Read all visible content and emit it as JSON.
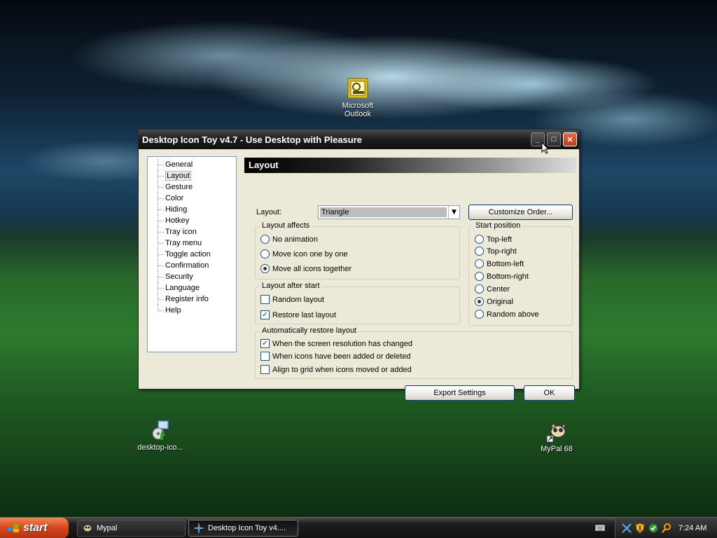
{
  "desktop": {
    "icons": [
      {
        "label_line1": "Microsoft",
        "label_line2": "Outlook",
        "icon": "outlook-icon"
      },
      {
        "label": "desktop-ico...",
        "icon": "installer-icon"
      },
      {
        "label": "MyPal 68",
        "icon": "mypal-icon"
      }
    ]
  },
  "window": {
    "title": "Desktop Icon Toy v4.7 - Use Desktop with Pleasure",
    "minimize": "_",
    "maximize": "□",
    "close": "✕"
  },
  "nav": {
    "items": [
      {
        "label": "General"
      },
      {
        "label": "Layout",
        "selected": true
      },
      {
        "label": "Gesture"
      },
      {
        "label": "Color"
      },
      {
        "label": "Hiding"
      },
      {
        "label": "Hotkey"
      },
      {
        "label": "Tray icon"
      },
      {
        "label": "Tray menu"
      },
      {
        "label": "Toggle action"
      },
      {
        "label": "Confirmation"
      },
      {
        "label": "Security"
      },
      {
        "label": "Language"
      },
      {
        "label": "Register info"
      },
      {
        "label": "Help"
      }
    ]
  },
  "panel": {
    "header": "Layout",
    "layout_label": "Layout:",
    "layout_value": "Triangle",
    "customize_button": "Customize Order...",
    "layout_affects": {
      "legend": "Layout affects",
      "options": [
        {
          "label": "No animation",
          "checked": false
        },
        {
          "label": "Move icon one by one",
          "checked": false
        },
        {
          "label": "Move all icons together",
          "checked": true
        }
      ]
    },
    "start_position": {
      "legend": "Start position",
      "options": [
        {
          "label": "Top-left",
          "checked": false
        },
        {
          "label": "Top-right",
          "checked": false
        },
        {
          "label": "Bottom-left",
          "checked": false
        },
        {
          "label": "Bottom-right",
          "checked": false
        },
        {
          "label": "Center",
          "checked": false
        },
        {
          "label": "Original",
          "checked": true
        },
        {
          "label": "Random above",
          "checked": false
        }
      ]
    },
    "layout_after_start": {
      "legend": "Layout after start",
      "options": [
        {
          "label": "Random layout",
          "checked": false
        },
        {
          "label": "Restore last layout",
          "checked": true
        }
      ]
    },
    "auto_restore": {
      "legend": "Automatically restore layout",
      "options": [
        {
          "label": "When the screen resolution has changed",
          "checked": true
        },
        {
          "label": "When icons have been added or deleted",
          "checked": false
        },
        {
          "label": "Align to grid when icons moved or added",
          "checked": false
        }
      ]
    },
    "export_button": "Export Settings",
    "ok_button": "OK"
  },
  "taskbar": {
    "start": "start",
    "tasks": [
      {
        "label": "Mypal",
        "active": false
      },
      {
        "label": "Desktop Icon Toy v4....",
        "active": true
      }
    ],
    "clock": "7:24 AM"
  }
}
